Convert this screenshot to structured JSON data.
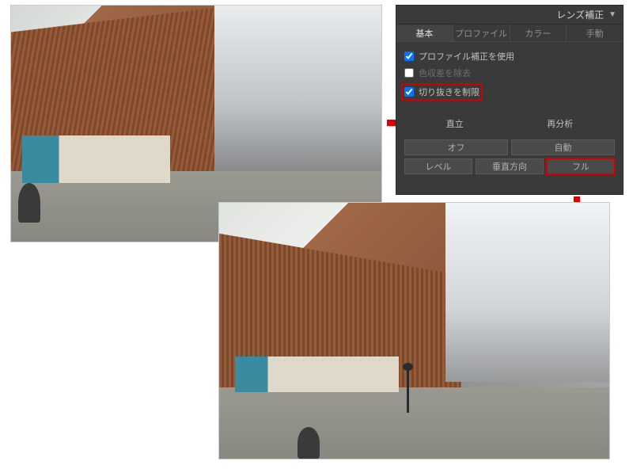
{
  "panel": {
    "title": "レンズ補正",
    "tabs": {
      "basic": "基本",
      "profile": "プロファイル",
      "color": "カラー",
      "manual": "手動"
    },
    "checkboxes": {
      "profile_correction": "プロファイル補正を使用",
      "remove_chromatic": "色収差を除去",
      "constrain_crop": "切り抜きを制限"
    },
    "upright": {
      "label": "直立",
      "reanalyze": "再分析"
    },
    "buttons": {
      "off": "オフ",
      "auto": "自動",
      "level": "レベル",
      "vertical": "垂直方向",
      "full": "フル"
    }
  }
}
